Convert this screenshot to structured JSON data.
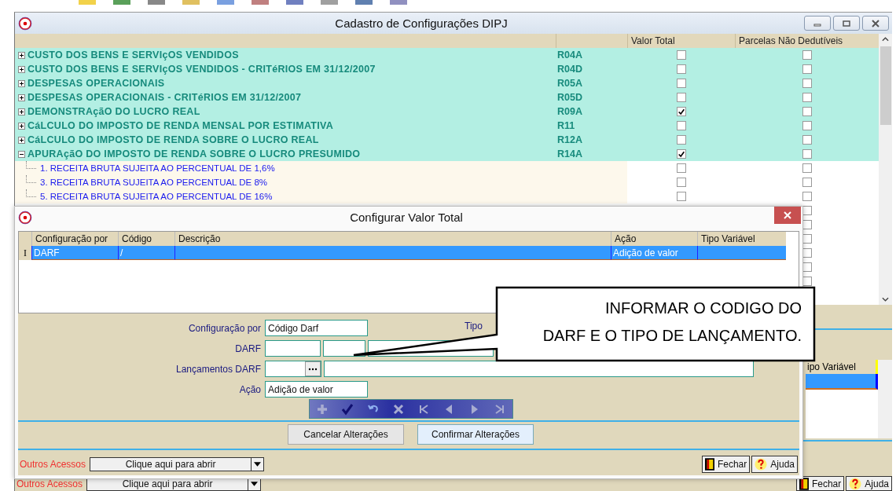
{
  "main_window": {
    "title": "Cadastro de Configurações DIPJ",
    "columns": [
      "Valor Total",
      "Parcelas Não Dedutíveis"
    ],
    "rows": [
      {
        "label": "CUSTO DOS BENS E SERVIçOS VENDIDOS",
        "code": "R04A",
        "expanded": false,
        "valor_total": false,
        "parcelas": false
      },
      {
        "label": "CUSTO DOS BENS E SERVIçOS VENDIDOS - CRITéRIOS EM 31/12/2007",
        "code": "R04D",
        "expanded": false,
        "valor_total": false,
        "parcelas": false
      },
      {
        "label": "DESPESAS OPERACIONAIS",
        "code": "R05A",
        "expanded": false,
        "valor_total": false,
        "parcelas": false
      },
      {
        "label": "DESPESAS OPERACIONAIS - CRITéRIOS EM 31/12/2007",
        "code": "R05D",
        "expanded": false,
        "valor_total": false,
        "parcelas": false
      },
      {
        "label": "DEMONSTRAçãO DO LUCRO REAL",
        "code": "R09A",
        "expanded": false,
        "valor_total": true,
        "parcelas": false
      },
      {
        "label": "CáLCULO DO IMPOSTO DE RENDA MENSAL POR ESTIMATIVA",
        "code": "R11",
        "expanded": false,
        "valor_total": false,
        "parcelas": false
      },
      {
        "label": "CáLCULO DO IMPOSTO DE RENDA SOBRE O LUCRO REAL",
        "code": "R12A",
        "expanded": false,
        "valor_total": false,
        "parcelas": false
      },
      {
        "label": "APURAçãO DO IMPOSTO DE RENDA SOBRE O LUCRO PRESUMIDO",
        "code": "R14A",
        "expanded": true,
        "valor_total": true,
        "parcelas": false,
        "children": [
          {
            "label": "1. RECEITA BRUTA SUJEITA AO PERCENTUAL DE 1,6%",
            "valor_total": false,
            "parcelas": false
          },
          {
            "label": "3. RECEITA BRUTA SUJEITA AO PERCENTUAL DE 8%",
            "valor_total": false,
            "parcelas": false
          },
          {
            "label": "5. RECEITA BRUTA SUJEITA AO PERCENTUAL DE 16%",
            "valor_total": false,
            "parcelas": false
          }
        ]
      }
    ],
    "covered_rows": [
      {
        "parcelas": false
      },
      {
        "parcelas": false
      },
      {
        "parcelas": false
      },
      {
        "parcelas": false
      },
      {
        "parcelas": false
      },
      {
        "parcelas": false
      }
    ],
    "detail_table": {
      "column": "ipo Variável",
      "row_selected": true
    },
    "footer": {
      "outros_label": "Outros Acessos",
      "dropdown": "Clique aqui para abrir",
      "close": "Fechar",
      "help": "Ajuda"
    }
  },
  "dialog": {
    "title": "Configurar Valor Total",
    "columns": [
      "Configuração por",
      "Código",
      "Descrição",
      "Ação",
      "Tipo Variável"
    ],
    "rows": [
      {
        "marker": "I",
        "configuracao": "DARF",
        "codigo": "/",
        "acao": "Adição de valor",
        "selected": true
      }
    ],
    "form": [
      {
        "kind": "text",
        "label": "Configuração por",
        "value": "Código Darf"
      },
      {
        "kind": "triple",
        "label": "DARF"
      },
      {
        "kind": "lookup",
        "label": "Lançamentos DARF"
      },
      {
        "kind": "text",
        "label": "Ação",
        "value": "Adição de valor"
      }
    ],
    "tipo_label": "Tipo",
    "nav": [
      {
        "kind": "add",
        "disabled": true
      },
      {
        "kind": "confirm",
        "disabled": false
      },
      {
        "kind": "undo",
        "disabled": false
      },
      {
        "kind": "delete",
        "disabled": true
      },
      {
        "kind": "first",
        "disabled": true
      },
      {
        "kind": "prev",
        "disabled": true
      },
      {
        "kind": "next",
        "disabled": true
      },
      {
        "kind": "last",
        "disabled": true
      }
    ],
    "buttons": [
      {
        "label": "Cancelar Alterações",
        "focused": false
      },
      {
        "label": "Confirmar Alterações",
        "focused": true
      }
    ],
    "footer": {
      "outros_label": "Outros Acessos",
      "dropdown": "Clique aqui para abrir",
      "close": "Fechar",
      "help": "Ajuda"
    }
  },
  "callout": {
    "lines": [
      "INFORMAR O CODIGO DO",
      "DARF E O TIPO DE LANÇAMENTO."
    ]
  }
}
